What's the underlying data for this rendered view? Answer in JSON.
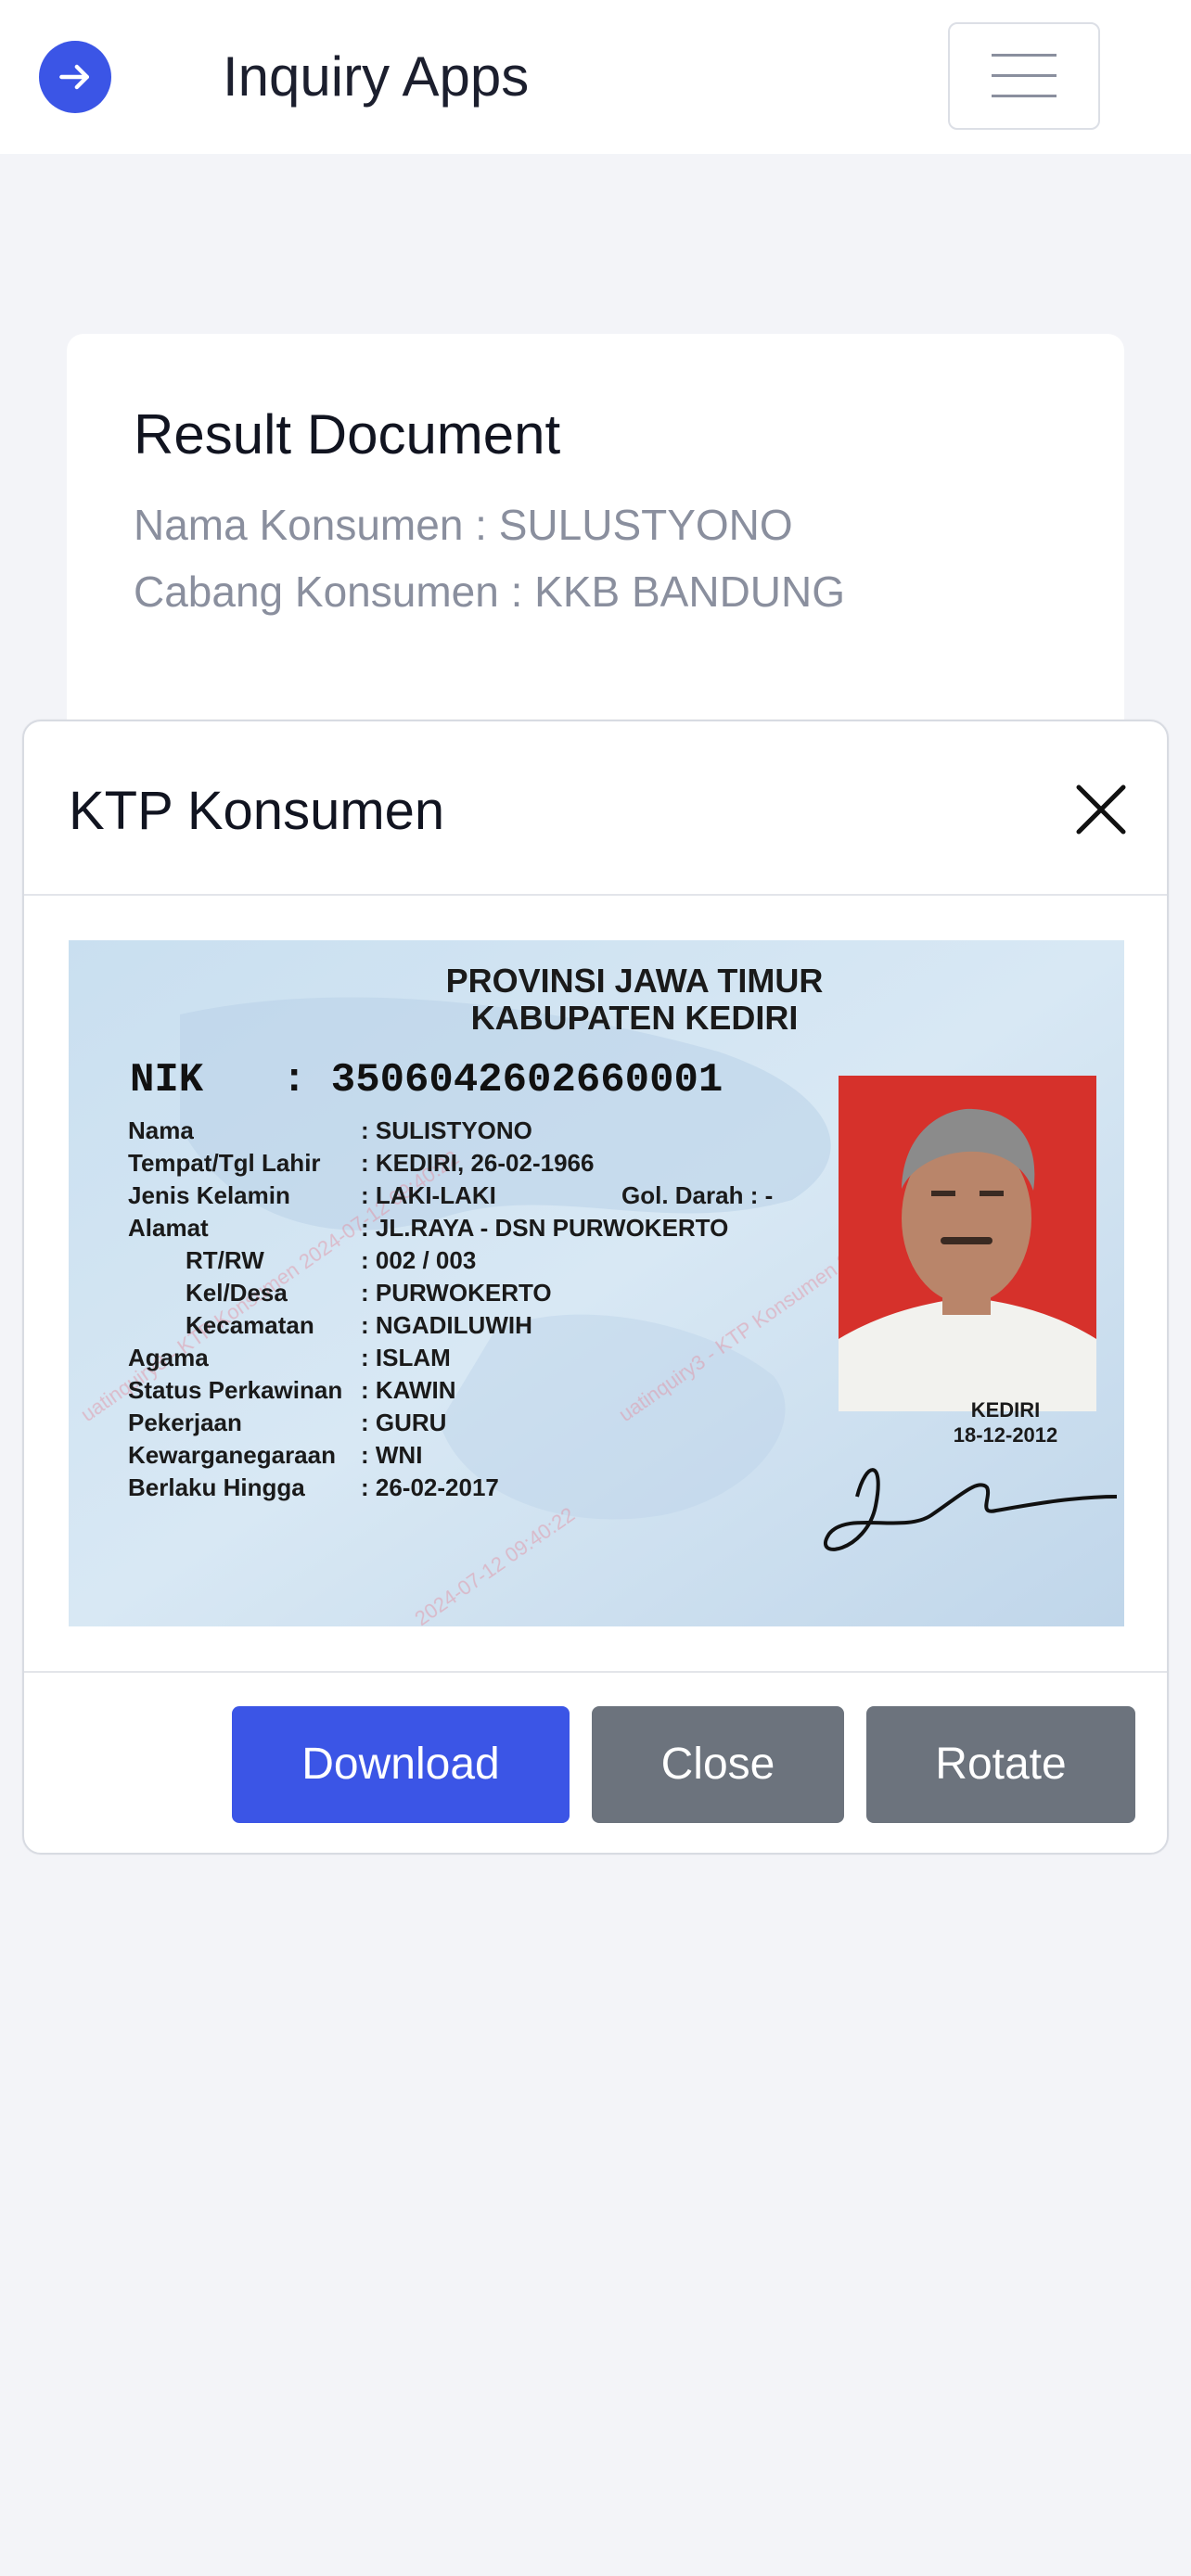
{
  "navbar": {
    "title": "Inquiry Apps",
    "logo_icon": "arrow-right-circle-icon",
    "toggle_icon": "hamburger-menu-icon"
  },
  "card": {
    "title": "Result Document",
    "customer_name": "Nama Konsumen : SULUSTYONO",
    "customer_branch": "Cabang Konsumen : KKB BANDUNG"
  },
  "modal": {
    "title": "KTP Konsumen",
    "close_icon": "close-icon",
    "buttons": {
      "download": "Download",
      "close": "Close",
      "rotate": "Rotate"
    }
  },
  "ktp": {
    "province": "PROVINSI JAWA TIMUR",
    "regency": "KABUPATEN KEDIRI",
    "nik_label": "NIK",
    "nik_value": ": 3506042602660001",
    "fields": [
      {
        "label": "Nama",
        "value": ": SULISTYONO"
      },
      {
        "label": "Tempat/Tgl Lahir",
        "value": ": KEDIRI, 26-02-1966"
      },
      {
        "label": "Jenis Kelamin",
        "value": ": LAKI-LAKI"
      },
      {
        "label": "Alamat",
        "value": ": JL.RAYA - DSN PURWOKERTO"
      },
      {
        "label": "RT/RW",
        "value": ": 002 / 003"
      },
      {
        "label": "Kel/Desa",
        "value": ": PURWOKERTO"
      },
      {
        "label": "Kecamatan",
        "value": ": NGADILUWIH"
      },
      {
        "label": "Agama",
        "value": ": ISLAM"
      },
      {
        "label": "Status Perkawinan",
        "value": ": KAWIN"
      },
      {
        "label": "Pekerjaan",
        "value": ": GURU"
      },
      {
        "label": "Kewarganegaraan",
        "value": ": WNI"
      },
      {
        "label": "Berlaku Hingga",
        "value": ": 26-02-2017"
      }
    ],
    "blood_type": "Gol. Darah : -",
    "issue_city": "KEDIRI",
    "issue_date": "18-12-2012"
  },
  "colors": {
    "primary": "#3b55e6",
    "secondary": "#6c737d",
    "background": "#f3f4f8"
  }
}
